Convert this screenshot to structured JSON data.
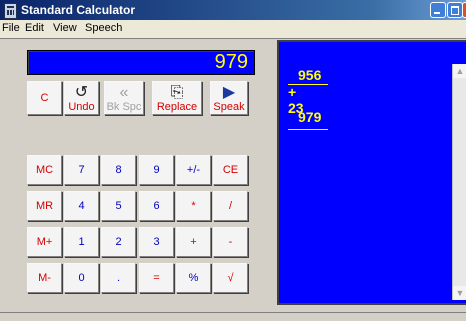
{
  "window": {
    "title": "Standard Calculator"
  },
  "menu": [
    "File",
    "Edit",
    "View",
    "Speech"
  ],
  "display": {
    "value": "979"
  },
  "buttons": {
    "clear": "C",
    "undo": "Undo",
    "backspace": "Bk Spc",
    "replace": "Replace",
    "speak": "Speak",
    "mc": "MC",
    "mr": "MR",
    "mplus": "M+",
    "mminus": "M-",
    "n7": "7",
    "n8": "8",
    "n9": "9",
    "plusminus": "+/-",
    "ce": "CE",
    "n4": "4",
    "n5": "5",
    "n6": "6",
    "mul": "*",
    "div": "/",
    "n1": "1",
    "n2": "2",
    "n3": "3",
    "add": "+",
    "sub": "-",
    "n0": "0",
    "dot": ".",
    "eq": "=",
    "pct": "%",
    "sqrt": "√"
  },
  "tape": {
    "line1": "956",
    "line2": "+ 23",
    "result": "979"
  },
  "colors": {
    "display_bg": "#0000ff",
    "display_fg": "#ffff00",
    "accent_red": "#d40000",
    "accent_blue": "#0000c0"
  }
}
